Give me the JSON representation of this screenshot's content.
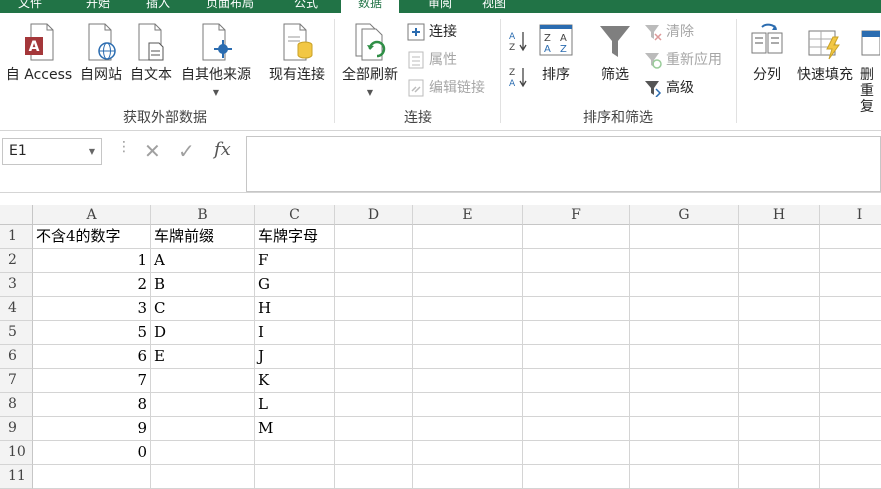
{
  "tabs": [
    {
      "label": "文件",
      "active": false
    },
    {
      "label": "开始",
      "active": false
    },
    {
      "label": "插入",
      "active": false
    },
    {
      "label": "页面布局",
      "active": false
    },
    {
      "label": "公式",
      "active": false
    },
    {
      "label": "数据",
      "active": true
    },
    {
      "label": "审阅",
      "active": false
    },
    {
      "label": "视图",
      "active": false
    }
  ],
  "ribbon": {
    "external": {
      "group_label": "获取外部数据",
      "access": "自 Access",
      "web": "自网站",
      "text": "自文本",
      "other": "自其他来源",
      "existing": "现有连接"
    },
    "connections": {
      "group_label": "连接",
      "refresh_all": "全部刷新",
      "connections": "连接",
      "properties": "属性",
      "edit_links": "编辑链接"
    },
    "sort_filter": {
      "group_label": "排序和筛选",
      "sort": "排序",
      "filter": "筛选",
      "clear": "清除",
      "reapply": "重新应用",
      "advanced": "高级"
    },
    "data_tools": {
      "split": "分列",
      "flash_fill": "快速填充",
      "remove_dup_top": "删",
      "remove_dup_bottom": "重复"
    }
  },
  "formula_bar": {
    "name_box": "E1",
    "fx": "fx",
    "formula": ""
  },
  "sheet": {
    "columns": [
      "A",
      "B",
      "C",
      "D",
      "E",
      "F",
      "G",
      "H",
      "I"
    ],
    "rows": [
      "1",
      "2",
      "3",
      "4",
      "5",
      "6",
      "7",
      "8",
      "9",
      "10",
      "11"
    ],
    "cells": [
      [
        "不含4的数字",
        "车牌前缀",
        "车牌字母"
      ],
      [
        "1",
        "A",
        "F"
      ],
      [
        "2",
        "B",
        "G"
      ],
      [
        "3",
        "C",
        "H"
      ],
      [
        "5",
        "D",
        "I"
      ],
      [
        "6",
        "E",
        "J"
      ],
      [
        "7",
        "",
        "K"
      ],
      [
        "8",
        "",
        "L"
      ],
      [
        "9",
        "",
        "M"
      ],
      [
        "0",
        "",
        ""
      ],
      [
        "",
        "",
        ""
      ]
    ]
  },
  "colors": {
    "excel_green": "#217346",
    "access_red": "#a4373a",
    "filter_gray": "#7f7f7f"
  }
}
